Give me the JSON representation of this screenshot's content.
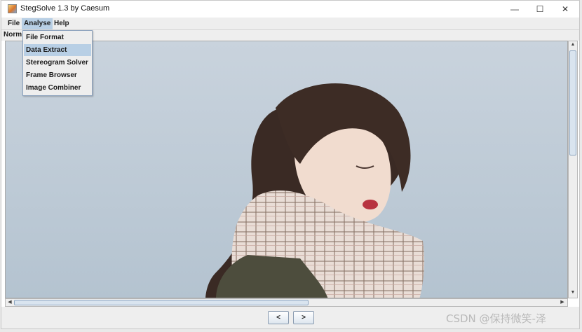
{
  "window": {
    "title": "StegSolve 1.3 by Caesum",
    "controls": {
      "minimize": "—",
      "maximize": "☐",
      "close": "✕"
    }
  },
  "menubar": {
    "items": [
      {
        "label": "File"
      },
      {
        "label": "Analyse",
        "open": true
      },
      {
        "label": "Help"
      }
    ]
  },
  "toolbar": {
    "mode_label": "Norm"
  },
  "dropdown": {
    "items": [
      {
        "label": "File Format",
        "highlighted": false
      },
      {
        "label": "Data Extract",
        "highlighted": true
      },
      {
        "label": "Stereogram Solver",
        "highlighted": false
      },
      {
        "label": "Frame Browser",
        "highlighted": false
      },
      {
        "label": "Image Combiner",
        "highlighted": false
      }
    ]
  },
  "navigation": {
    "prev_label": "<",
    "next_label": ">"
  },
  "scroll": {
    "up": "▲",
    "down": "▼",
    "left": "◀",
    "right": "▶"
  },
  "image": {
    "subject": "photo of a woman with a plaid scarf against a pale blue-grey sky"
  },
  "watermark": "CSDN @保持微笑-泽",
  "colors": {
    "menu_highlight": "#b8cfe5",
    "background": "#eeeeee",
    "sky": "#bccad5"
  }
}
